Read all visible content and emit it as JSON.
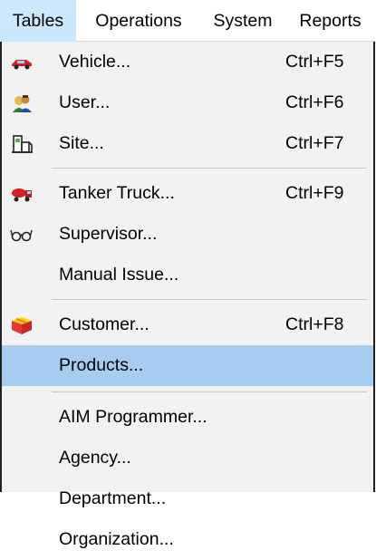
{
  "menubar": {
    "items": [
      {
        "label": "Tables",
        "active": true
      },
      {
        "label": "Operations",
        "active": false
      },
      {
        "label": "System",
        "active": false
      },
      {
        "label": "Reports",
        "active": false
      }
    ]
  },
  "menu": {
    "items": [
      {
        "label": "Vehicle...",
        "shortcut": "Ctrl+F5",
        "icon": "car-icon"
      },
      {
        "label": "User...",
        "shortcut": "Ctrl+F6",
        "icon": "user-icon"
      },
      {
        "label": "Site...",
        "shortcut": "Ctrl+F7",
        "icon": "site-icon"
      },
      {
        "label": "Tanker Truck...",
        "shortcut": "Ctrl+F9",
        "icon": "tanker-truck-icon"
      },
      {
        "label": "Supervisor...",
        "shortcut": "",
        "icon": "glasses-icon"
      },
      {
        "label": "Manual Issue...",
        "shortcut": "",
        "icon": ""
      },
      {
        "label": "Customer...",
        "shortcut": "Ctrl+F8",
        "icon": "customer-icon"
      },
      {
        "label": "Products...",
        "shortcut": "",
        "icon": "",
        "highlighted": true
      },
      {
        "label": "AIM Programmer...",
        "shortcut": "",
        "icon": ""
      },
      {
        "label": "Agency...",
        "shortcut": "",
        "icon": ""
      },
      {
        "label": "Department...",
        "shortcut": "",
        "icon": ""
      },
      {
        "label": "Organization...",
        "shortcut": "",
        "icon": ""
      }
    ]
  },
  "colors": {
    "menubar_active": "#cce8ff",
    "item_highlight": "#a6cdf0",
    "menu_background": "#f2f2f2"
  }
}
